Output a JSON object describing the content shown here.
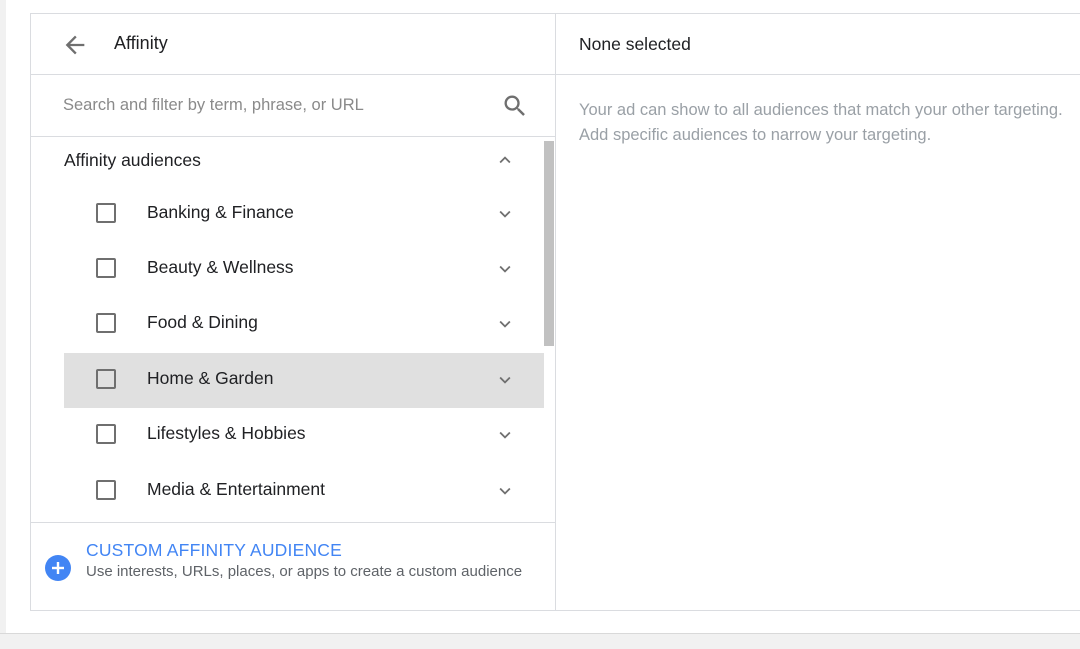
{
  "left_panel": {
    "title": "Affinity",
    "search": {
      "placeholder": "Search and filter by term, phrase, or URL",
      "value": ""
    },
    "group": {
      "label": "Affinity audiences",
      "expanded": true
    },
    "items": [
      {
        "label": "Banking & Finance",
        "checked": false
      },
      {
        "label": "Beauty & Wellness",
        "checked": false
      },
      {
        "label": "Food & Dining",
        "checked": false
      },
      {
        "label": "Home & Garden",
        "checked": false,
        "hovered": true
      },
      {
        "label": "Lifestyles & Hobbies",
        "checked": false
      },
      {
        "label": "Media & Entertainment",
        "checked": false
      }
    ],
    "custom": {
      "title": "CUSTOM AFFINITY AUDIENCE",
      "description": "Use interests, URLs, places, or apps to create a custom audience"
    }
  },
  "right_panel": {
    "title": "None selected",
    "description": "Your ad can show to all audiences that match your other targeting. Add specific audiences to narrow your targeting."
  },
  "icons": {
    "back": "arrow-back-icon",
    "search": "search-icon",
    "collapse": "chevron-up-icon",
    "expand": "chevron-down-icon",
    "add": "plus-circle-icon"
  },
  "colors": {
    "accent": "#4285f4",
    "hover_row": "#e0e0e0",
    "border": "#dadce0",
    "muted_text": "#9aa0a6"
  }
}
